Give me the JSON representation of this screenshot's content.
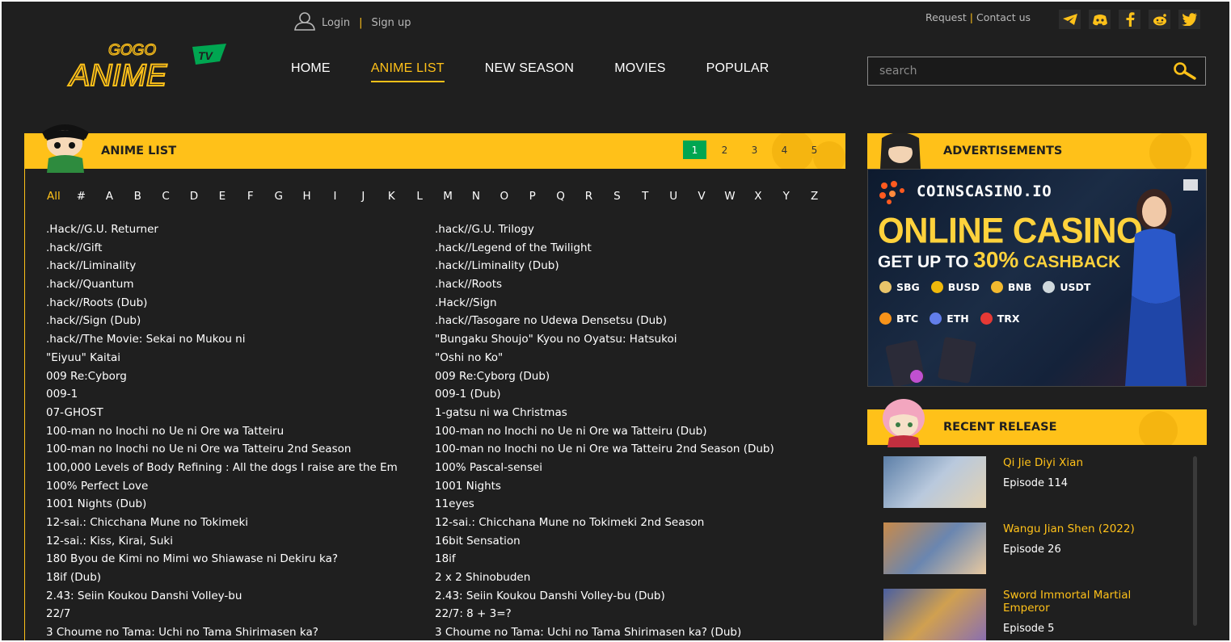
{
  "header": {
    "login": "Login",
    "signup": "Sign up",
    "request": "Request",
    "contact": "Contact us",
    "logo_text_top": "GOGO",
    "logo_text_main": "ANIME",
    "logo_badge": "TV"
  },
  "nav": [
    "HOME",
    "ANIME LIST",
    "NEW SEASON",
    "MOVIES",
    "POPULAR"
  ],
  "search": {
    "placeholder": "search"
  },
  "anime_list": {
    "title": "ANIME LIST",
    "pages": [
      "1",
      "2",
      "3",
      "4",
      "5"
    ],
    "letters": [
      "All",
      "#",
      "A",
      "B",
      "C",
      "D",
      "E",
      "F",
      "G",
      "H",
      "I",
      "J",
      "K",
      "L",
      "M",
      "N",
      "O",
      "P",
      "Q",
      "R",
      "S",
      "T",
      "U",
      "V",
      "W",
      "X",
      "Y",
      "Z"
    ],
    "left": [
      ".Hack//G.U. Returner",
      ".hack//Gift",
      ".hack//Liminality",
      ".hack//Quantum",
      ".hack//Roots (Dub)",
      ".hack//Sign (Dub)",
      ".hack//The Movie: Sekai no Mukou ni",
      "\"Eiyuu\" Kaitai",
      "009 Re:Cyborg",
      "009-1",
      "07-GHOST",
      "100-man no Inochi no Ue ni Ore wa Tatteiru",
      "100-man no Inochi no Ue ni Ore wa Tatteiru 2nd Season",
      "100,000 Levels of Body Refining : All the dogs I raise are the Em",
      "100% Perfect Love",
      "1001 Nights (Dub)",
      "12-sai.: Chicchana Mune no Tokimeki",
      "12-sai.: Kiss, Kirai, Suki",
      "180 Byou de Kimi no Mimi wo Shiawase ni Dekiru ka?",
      "18if (Dub)",
      "2.43: Seiin Koukou Danshi Volley-bu",
      "22/7",
      "3 Choume no Tama: Uchi no Tama Shirimasen ka?"
    ],
    "right": [
      ".hack//G.U. Trilogy",
      ".hack//Legend of the Twilight",
      ".hack//Liminality (Dub)",
      ".hack//Roots",
      ".Hack//Sign",
      ".hack//Tasogare no Udewa Densetsu (Dub)",
      "\"Bungaku Shoujo\" Kyou no Oyatsu: Hatsukoi",
      "\"Oshi no Ko\"",
      "009 Re:Cyborg (Dub)",
      "009-1 (Dub)",
      "1-gatsu ni wa Christmas",
      "100-man no Inochi no Ue ni Ore wa Tatteiru (Dub)",
      "100-man no Inochi no Ue ni Ore wa Tatteiru 2nd Season (Dub)",
      "100% Pascal-sensei",
      "1001 Nights",
      "11eyes",
      "12-sai.: Chicchana Mune no Tokimeki 2nd Season",
      "16bit Sensation",
      "18if",
      "2 x 2 Shinobuden",
      "2.43: Seiin Koukou Danshi Volley-bu (Dub)",
      "22/7: 8 + 3=?",
      "3 Choume no Tama: Uchi no Tama Shirimasen ka? (Dub)"
    ]
  },
  "ads": {
    "title": "ADVERTISEMENTS",
    "brand": "COINSCASINO.IO",
    "headline": "ONLINE CASINO",
    "sub_pre": "GET UP TO",
    "sub_pct": "30%",
    "sub_post": "CASHBACK",
    "coins": [
      {
        "name": "SBG",
        "color": "#e9c46a"
      },
      {
        "name": "BUSD",
        "color": "#f0b90b"
      },
      {
        "name": "BNB",
        "color": "#f3ba2f"
      },
      {
        "name": "USDT",
        "color": "#cfd8dc"
      },
      {
        "name": "BTC",
        "color": "#f7931a"
      },
      {
        "name": "ETH",
        "color": "#627eea"
      },
      {
        "name": "TRX",
        "color": "#e53935"
      }
    ]
  },
  "recent": {
    "title": "RECENT RELEASE",
    "items": [
      {
        "name": "Qi Jie Diyi Xian",
        "episode": "Episode 114"
      },
      {
        "name": "Wangu Jian Shen (2022)",
        "episode": "Episode 26"
      },
      {
        "name": "Sword Immortal Martial Emperor",
        "episode": "Episode 5"
      }
    ]
  },
  "colors": {
    "accent": "#ffc119",
    "background": "#1f1f1f",
    "page_active": "#00a651"
  }
}
